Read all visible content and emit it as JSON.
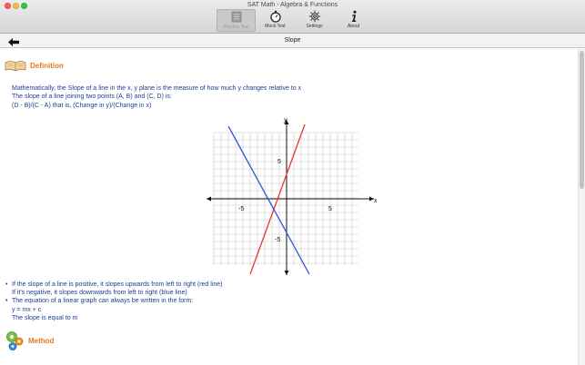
{
  "window": {
    "title": "SAT Math - Algebra & Functions"
  },
  "toolbar": {
    "items": [
      {
        "label": "Practice Test",
        "icon": "notebook-icon",
        "active": true
      },
      {
        "label": "Mock Test",
        "icon": "stopwatch-icon",
        "active": false
      },
      {
        "label": "Settings",
        "icon": "gear-icon",
        "active": false
      },
      {
        "label": "About",
        "icon": "info-icon",
        "active": false
      }
    ]
  },
  "nav": {
    "title": "Slope"
  },
  "definition": {
    "heading": "Definition",
    "lines": [
      "Mathematically, the Slope of a line in the x, y plane is the measure of how much y changes relative to x",
      "The slope of a line joining two points (A, B) and (C, D) is:",
      "(D - B)/(C - A) that is, (Change in y)/(Change in x)"
    ]
  },
  "graph": {
    "x_axis_label": "x",
    "y_axis_label": "y",
    "ticks": {
      "x_neg": "-5",
      "x_pos": "5",
      "y_pos": "5",
      "y_neg": "-5"
    },
    "colors": {
      "positive_line": "#e8372f",
      "negative_line": "#2f55d8",
      "grid": "#c8c8c8",
      "axis": "#111111"
    }
  },
  "notes": {
    "b1": "If the slope of a line is positive, it slopes upwards from left to right (red line)",
    "b1_sub": "If it's negative, it slopes downwards from left to right (blue line)",
    "b2": "The equation of a linear graph can always be written in the form:",
    "b2_sub1": "y = mx + c",
    "b2_sub2": "The slope is equal to m"
  },
  "method": {
    "heading": "Method"
  }
}
